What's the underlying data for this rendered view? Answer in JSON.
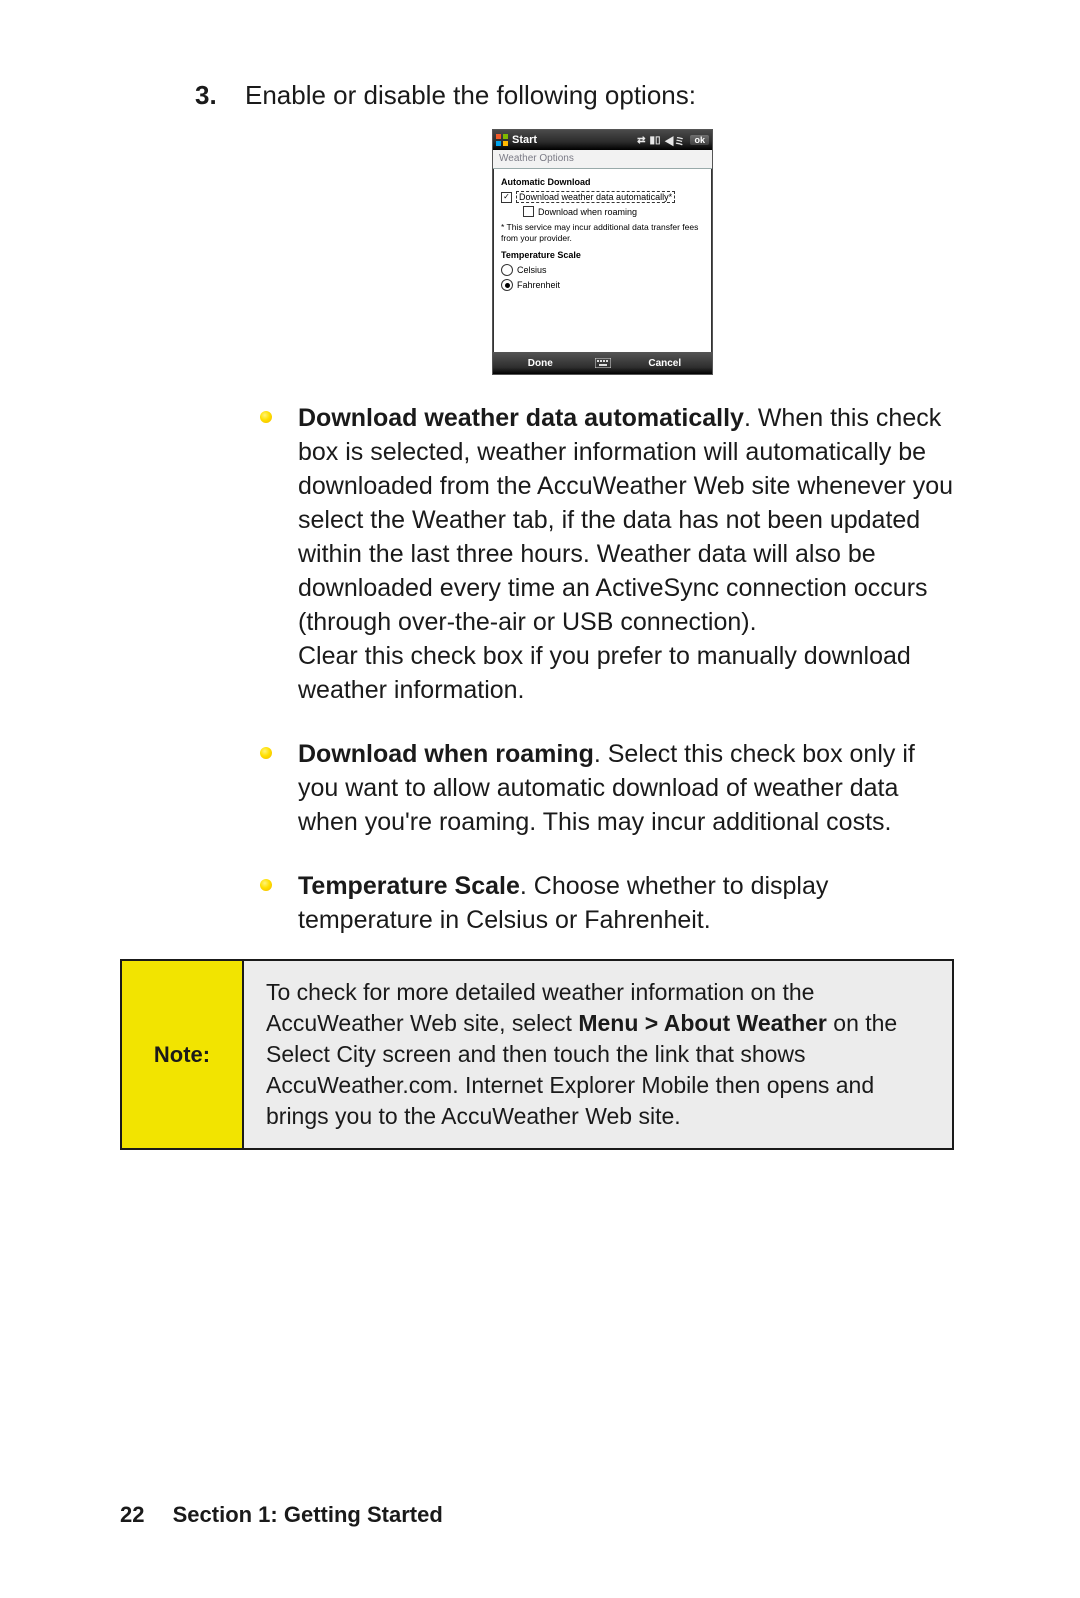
{
  "step": {
    "number": "3.",
    "text": "Enable or disable the following options:"
  },
  "phone": {
    "titlebar": {
      "start": "Start",
      "ok": "ok"
    },
    "subtitle": "Weather Options",
    "section_auto": "Automatic Download",
    "cb_auto": "Download weather data automatically*",
    "cb_roam": "Download when roaming",
    "service_note": "* This service may incur additional data transfer fees from your provider.",
    "section_temp": "Temperature Scale",
    "radio_c": "Celsius",
    "radio_f": "Fahrenheit",
    "done": "Done",
    "cancel": "Cancel"
  },
  "bullets": {
    "b1_strong": "Download weather data automatically",
    "b1_a": ". When this check box is selected, weather information will automatically be downloaded from the AccuWeather Web site whenever you select the Weather tab, if the data has not been updated within the last three hours. Weather data will also be downloaded every time an ActiveSync connection occurs (through over-the-air or USB connection).",
    "b1_b": "Clear this check box if you prefer to manually download weather information.",
    "b2_strong": "Download when roaming",
    "b2_a": ". Select this check box only if you want to allow automatic download of weather data when you're roaming. This may incur additional costs.",
    "b3_strong": "Temperature Scale",
    "b3_a": ". Choose whether to display temperature in Celsius or Fahrenheit."
  },
  "note": {
    "label": "Note:",
    "body_a": "To check for more detailed weather information on the AccuWeather Web site, select ",
    "body_strong": "Menu > About Weather",
    "body_b": " on the Select City screen and then touch the link that shows AccuWeather.com. Internet Explorer Mobile then opens and brings you to the AccuWeather Web site."
  },
  "footer": {
    "page": "22",
    "section": "Section 1: Getting Started"
  }
}
